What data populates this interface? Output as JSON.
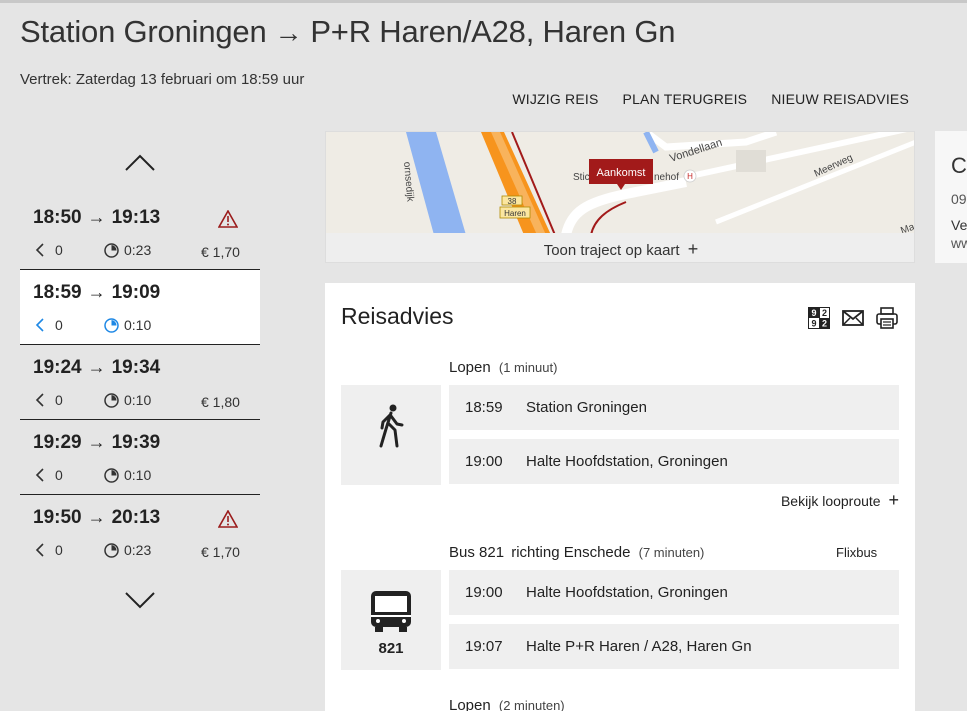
{
  "header": {
    "origin": "Station Groningen",
    "arrow": "→",
    "destination": "P+R Haren/A28, Haren Gn",
    "departure": "Vertrek: Zaterdag 13 februari om 18:59 uur"
  },
  "actions": [
    "WIJZIG REIS",
    "PLAN TERUGREIS",
    "NIEUW REISADVIES"
  ],
  "trips": [
    {
      "dep": "18:50",
      "arr": "19:13",
      "transfers": "0",
      "duration": "0:23",
      "price": "€ 1,70",
      "warning": true,
      "selected": false
    },
    {
      "dep": "18:59",
      "arr": "19:09",
      "transfers": "0",
      "duration": "0:10",
      "price": "",
      "warning": false,
      "selected": true
    },
    {
      "dep": "19:24",
      "arr": "19:34",
      "transfers": "0",
      "duration": "0:10",
      "price": "€ 1,80",
      "warning": false,
      "selected": false
    },
    {
      "dep": "19:29",
      "arr": "19:39",
      "transfers": "0",
      "duration": "0:10",
      "price": "",
      "warning": false,
      "selected": false
    },
    {
      "dep": "19:50",
      "arr": "20:13",
      "transfers": "0",
      "duration": "0:23",
      "price": "€ 1,70",
      "warning": true,
      "selected": false
    }
  ],
  "map": {
    "labels": {
      "street1": "ornsedijk",
      "street2": "Vondellaan",
      "street3": "Meerweg",
      "stop_prefix": "Stic",
      "stop_suffix": "nehof",
      "h": "H",
      "num": "38",
      "place": "Haren",
      "ma": "Ma"
    },
    "marker": "Aankomst",
    "link": "Toon traject op kaart",
    "link_icon": "+"
  },
  "side": {
    "c": "C",
    "n": "09",
    "v": "Ve",
    "w": "ww"
  },
  "advice": {
    "title": "Reisadvies",
    "legs": [
      {
        "mode_text": "Lopen",
        "detail": "(1 minuut)",
        "operator": "",
        "mode_label": "",
        "stops": [
          {
            "time": "18:59",
            "name": "Station Groningen"
          },
          {
            "time": "19:00",
            "name": "Halte Hoofdstation, Groningen"
          }
        ],
        "link": "Bekijk looproute",
        "link_icon": "+"
      },
      {
        "mode_text": "Bus 821",
        "direction": "richting Enschede",
        "detail": "(7 minuten)",
        "operator": "Flixbus",
        "mode_label": "821",
        "stops": [
          {
            "time": "19:00",
            "name": "Halte Hoofdstation, Groningen"
          },
          {
            "time": "19:07",
            "name": "Halte P+R Haren / A28, Haren Gn"
          }
        ]
      },
      {
        "mode_text": "Lopen",
        "detail": "(2 minuten)"
      }
    ]
  },
  "colors": {
    "accent": "#1e88e5",
    "warning": "#9b1c1c",
    "marker": "#a21a1a",
    "route": "#f7941d"
  }
}
